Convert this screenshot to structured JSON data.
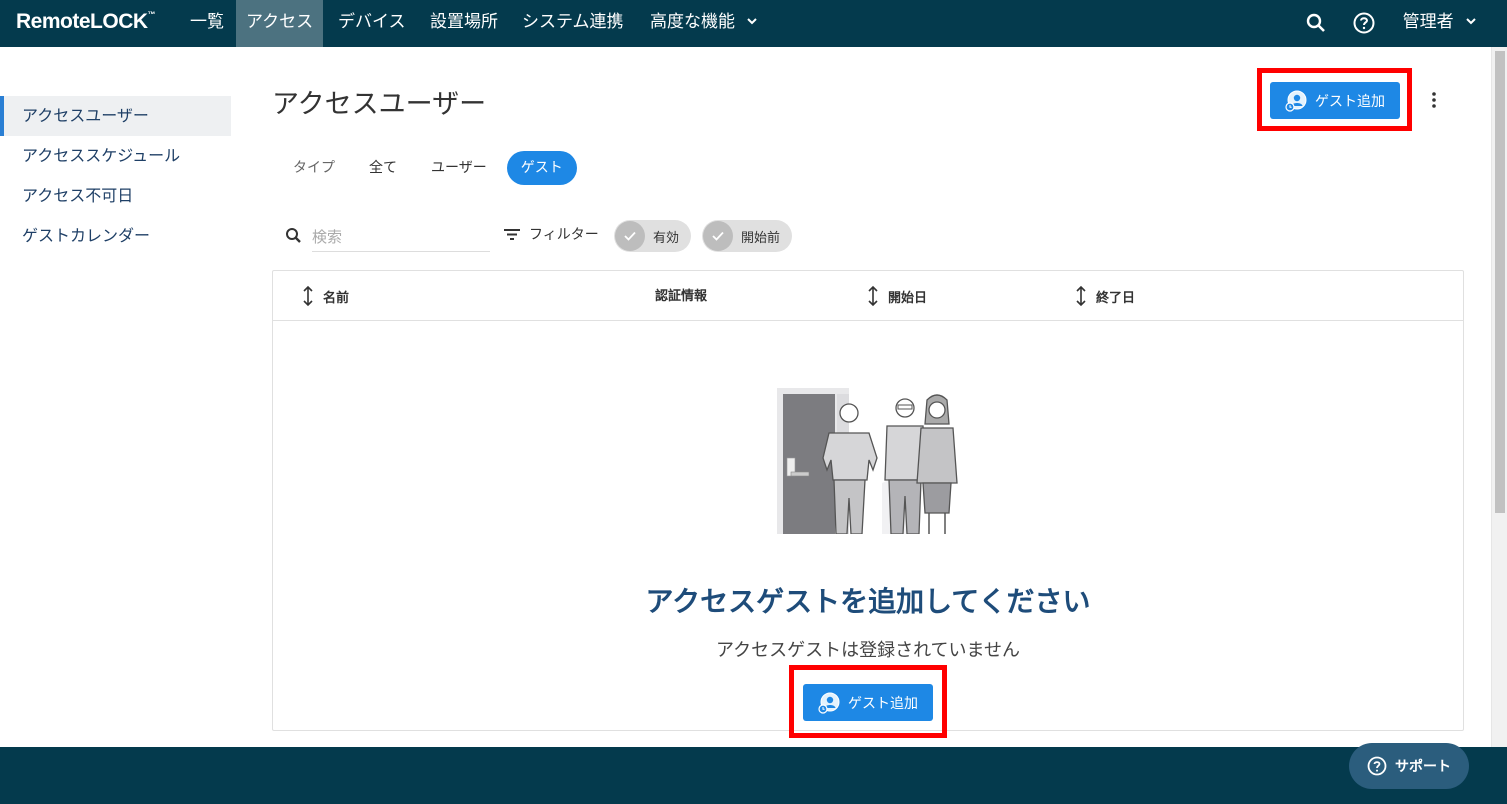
{
  "header": {
    "logo": {
      "remote": "Remote",
      "lock": "LOCK",
      "tm": "™"
    },
    "nav": [
      "一覧",
      "アクセス",
      "デバイス",
      "設置場所",
      "システム連携",
      "高度な機能"
    ],
    "user": "管理者"
  },
  "sidebar": {
    "items": [
      {
        "label": "アクセスユーザー"
      },
      {
        "label": "アクセススケジュール"
      },
      {
        "label": "アクセス不可日"
      },
      {
        "label": "ゲストカレンダー"
      }
    ]
  },
  "page": {
    "title": "アクセスユーザー",
    "add_guest_label": "ゲスト追加"
  },
  "tabs": {
    "type_label": "タイプ",
    "items": [
      "全て",
      "ユーザー",
      "ゲスト"
    ]
  },
  "search": {
    "placeholder": "検索"
  },
  "filter": {
    "label": "フィルター",
    "chips": [
      "有効",
      "開始前"
    ]
  },
  "table": {
    "columns": [
      "名前",
      "認証情報",
      "開始日",
      "終了日"
    ]
  },
  "empty_state": {
    "title": "アクセスゲストを追加してください",
    "subtitle": "アクセスゲストは登録されていません",
    "button_label": "ゲスト追加"
  },
  "support": {
    "label": "サポート"
  },
  "colors": {
    "nav_bg": "#043a4d",
    "primary": "#1e88e5",
    "highlight": "#ff0000",
    "title_blue": "#1e4c7a"
  }
}
